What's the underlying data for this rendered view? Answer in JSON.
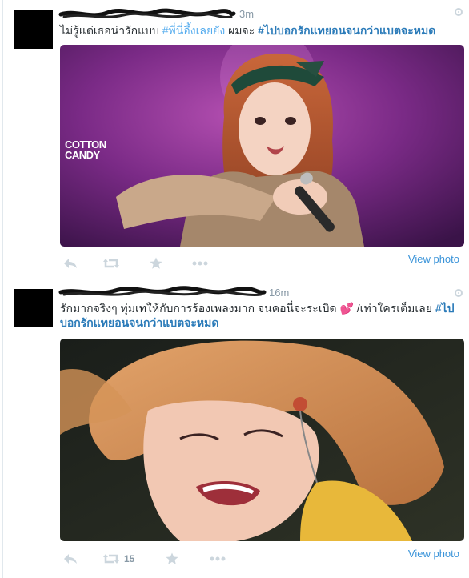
{
  "tweets": [
    {
      "time": "3m",
      "text_plain": "ไม่รู้แต่เธอน่ารักแบบ ",
      "hashtag1": "#พี่นี่อึ้งเลยยัง",
      "text_mid": " ผมจะ ",
      "hashtag2": "#ไปบอกรักแทยอนจนกว่าแบตจะหมด",
      "media_watermark_line1": "COTTON",
      "media_watermark_line2": "CANDY",
      "retweet_count": "",
      "view_photo": "View photo"
    },
    {
      "time": "16m",
      "text_plain": "รักมากจริงๆ ทุ่มเทให้กับการร้องเพลงมาก จนคอนี่จะระเบิด ",
      "emoji": "💕",
      "text_mid": " /เท่าใครเต็มเลย ",
      "hashtag2": "#ไปบอกรักแทยอนจนกว่าแบตจะหมด",
      "retweet_count": "15",
      "view_photo": "View photo"
    }
  ],
  "icons": [
    "reply-icon",
    "retweet-icon",
    "favorite-icon",
    "more-icon",
    "options-icon"
  ],
  "colors": {
    "hashtag": "#2b7bb9",
    "link": "#3b94d9",
    "action_icon": "#ccd6dd",
    "meta": "#8899a6"
  }
}
